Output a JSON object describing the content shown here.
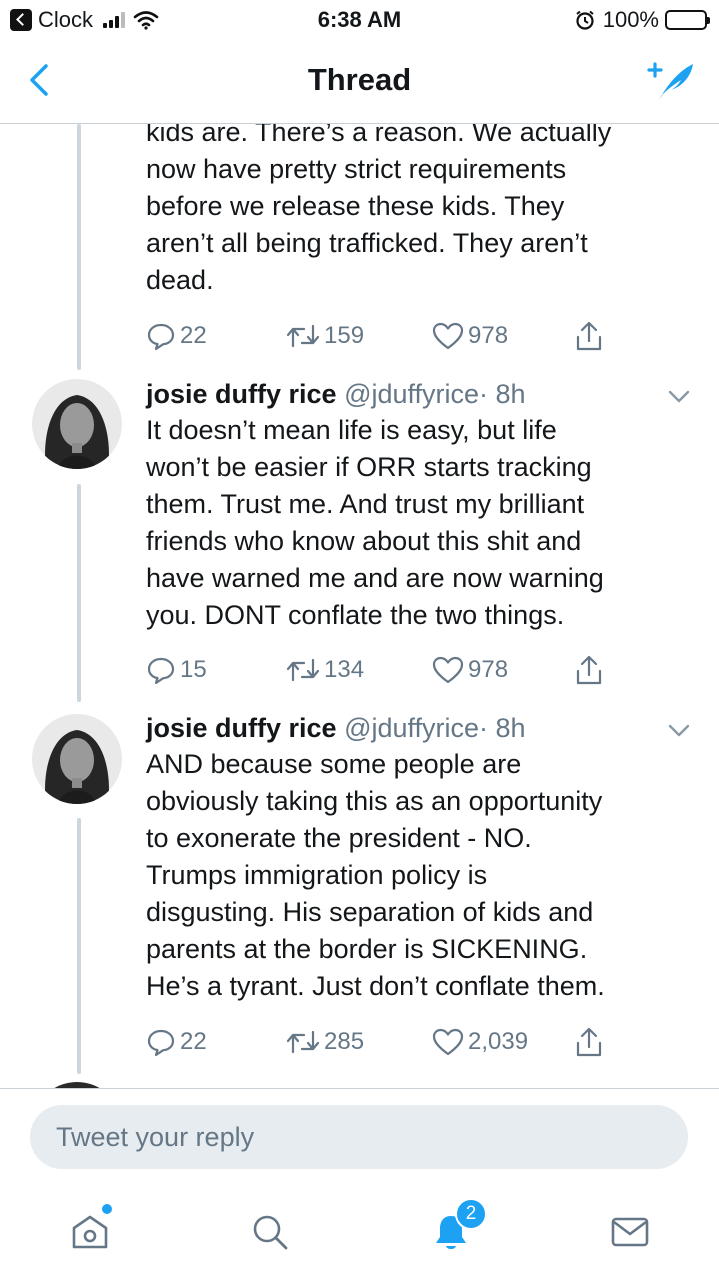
{
  "status_bar": {
    "back_app": "Clock",
    "time": "6:38 AM",
    "battery": "100%",
    "icons": [
      "back-arrow-icon",
      "signal-icon",
      "wifi-icon",
      "alarm-icon",
      "battery-icon"
    ]
  },
  "nav": {
    "title": "Thread",
    "back_icon": "chevron-left-icon",
    "compose_icon": "compose-tweet-icon",
    "accent_color": "#1da1f2"
  },
  "tweets": [
    {
      "text": "kids are. There’s a reason. We actually\nnow have pretty strict requirements\nbefore we release these kids. They\naren’t all being trafficked. They aren’t\ndead.",
      "replies": "22",
      "retweets": "159",
      "likes": "978"
    },
    {
      "name": "josie duffy rice",
      "handle": "@jduffyrice",
      "time": "· 8h",
      "text": "It doesn’t mean life is easy, but life\nwon’t be easier if ORR starts tracking\nthem. Trust me. And trust my brilliant\nfriends who know about this shit and\nhave warned me and are now warning\nyou. DONT conflate the two things.",
      "replies": "15",
      "retweets": "134",
      "likes": "978"
    },
    {
      "name": "josie duffy rice",
      "handle": "@jduffyrice",
      "time": "· 8h",
      "text": "AND because some people are\nobviously taking this as an opportunity\nto exonerate the president - NO.\nTrumps immigration policy is\ndisgusting. His separation of kids and\nparents at the border is SICKENING.\nHe’s a tyrant. Just don’t conflate them.",
      "replies": "22",
      "retweets": "285",
      "likes": "2,039"
    }
  ],
  "reply_bar": {
    "placeholder": "Tweet your reply"
  },
  "tab_bar": {
    "items": [
      "home-icon",
      "search-icon",
      "notifications-icon",
      "messages-icon"
    ],
    "notification_count": "2"
  }
}
